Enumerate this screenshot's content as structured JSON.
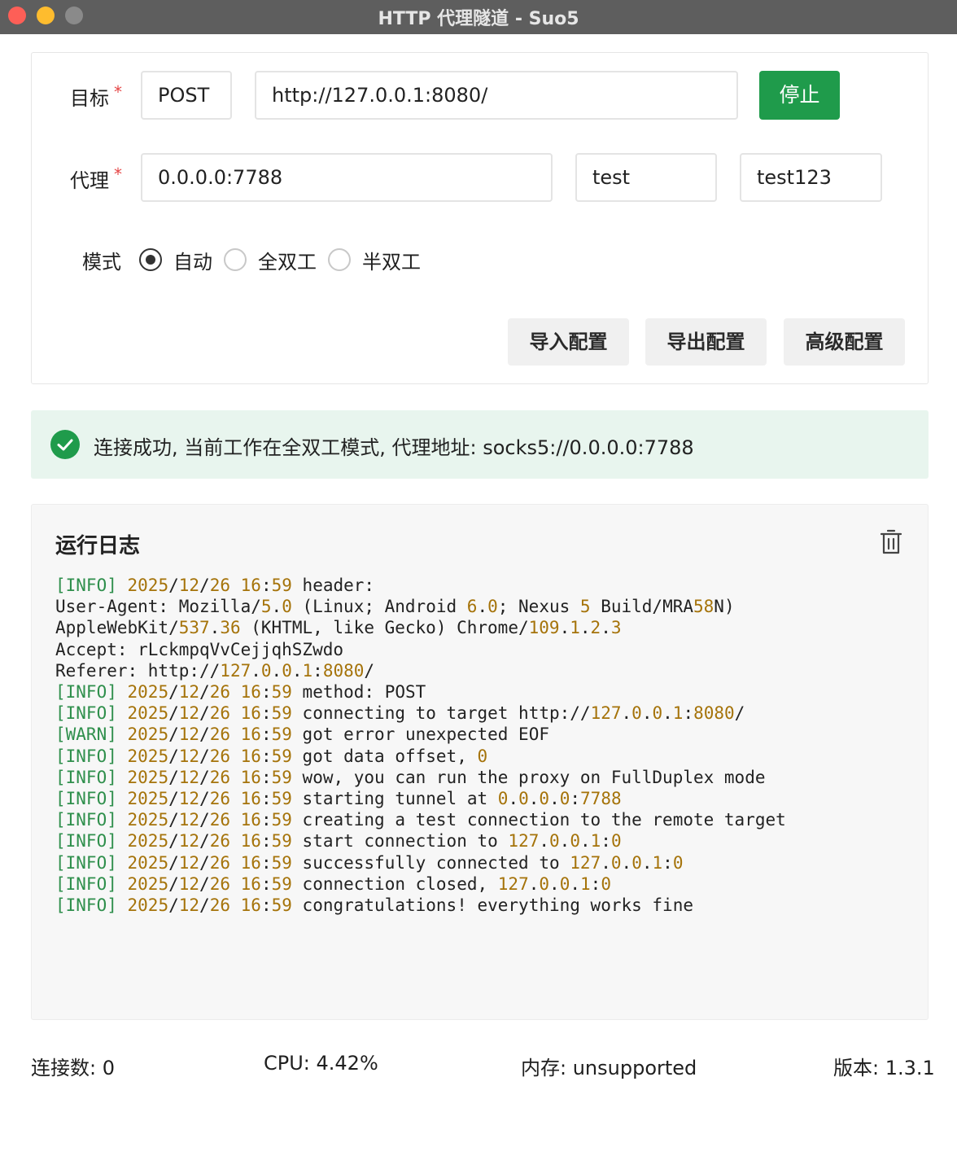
{
  "window": {
    "title": "HTTP 代理隧道 - Suo5"
  },
  "config": {
    "target_label": "目标",
    "required_mark": "*",
    "method_value": "POST",
    "url_value": "http://127.0.0.1:8080/",
    "stop_button": "停止",
    "proxy_label": "代理",
    "proxy_value": "0.0.0.0:7788",
    "username_value": "test",
    "password_value": "test123",
    "mode_label": "模式",
    "modes": [
      {
        "label": "自动",
        "selected": true
      },
      {
        "label": "全双工",
        "selected": false
      },
      {
        "label": "半双工",
        "selected": false
      }
    ],
    "import_button": "导入配置",
    "export_button": "导出配置",
    "advanced_button": "高级配置"
  },
  "banner": {
    "icon": "check-circle-icon",
    "message": "连接成功, 当前工作在全双工模式, 代理地址: socks5://0.0.0.0:7788",
    "color": "#1f9b4b"
  },
  "log": {
    "title": "运行日志",
    "clear_icon": "trash-icon",
    "lines": [
      "[INFO] 2025/12/26 16:59 header:",
      "User-Agent: Mozilla/5.0 (Linux; Android 6.0; Nexus 5 Build/MRA58N)",
      "AppleWebKit/537.36 (KHTML, like Gecko) Chrome/109.1.2.3",
      "Accept: rLckmpqVvCejjqhSZwdo",
      "Referer: http://127.0.0.1:8080/",
      "[INFO] 2025/12/26 16:59 method: POST",
      "[INFO] 2025/12/26 16:59 connecting to target http://127.0.0.1:8080/",
      "[WARN] 2025/12/26 16:59 got error unexpected EOF",
      "[INFO] 2025/12/26 16:59 got data offset, 0",
      "[INFO] 2025/12/26 16:59 wow, you can run the proxy on FullDuplex mode",
      "[INFO] 2025/12/26 16:59 starting tunnel at 0.0.0.0:7788",
      "[INFO] 2025/12/26 16:59 creating a test connection to the remote target",
      "[INFO] 2025/12/26 16:59 start connection to 127.0.0.1:0",
      "[INFO] 2025/12/26 16:59 successfully connected to 127.0.0.1:0",
      "[INFO] 2025/12/26 16:59 connection closed, 127.0.0.1:0",
      "[INFO] 2025/12/26 16:59 congratulations! everything works fine"
    ]
  },
  "status": {
    "connections": "连接数: 0",
    "cpu": "CPU: 4.42%",
    "memory": "内存: unsupported",
    "version": "版本: 1.3.1"
  },
  "colors": {
    "accent": "#1f9b4b",
    "required": "#e54545",
    "log_level": "#2f8f4c",
    "log_number": "#a5730a"
  }
}
